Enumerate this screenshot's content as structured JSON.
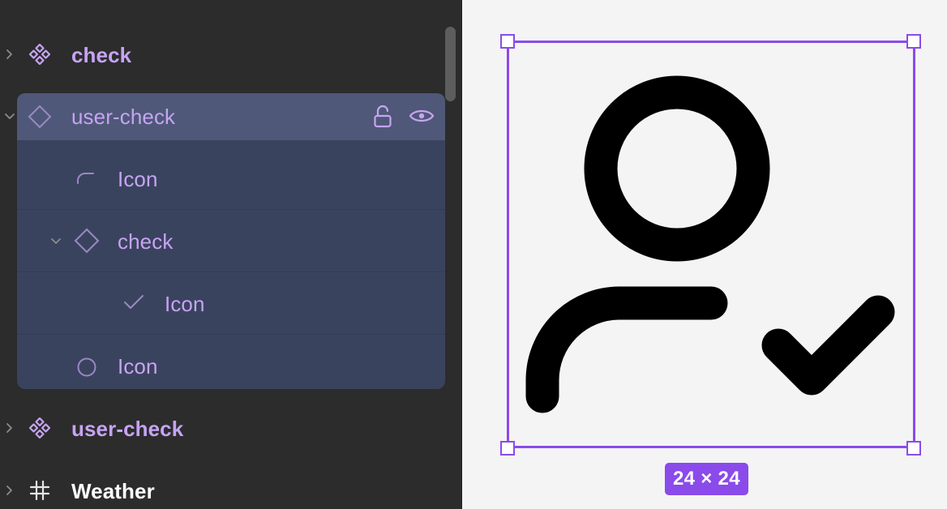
{
  "layers": {
    "items": [
      {
        "label": "check",
        "kind": "component"
      },
      {
        "label": "user-check",
        "kind": "instance",
        "selected": true,
        "children": [
          {
            "label": "Icon",
            "kind": "path"
          },
          {
            "label": "check",
            "kind": "instance"
          },
          {
            "label": "Icon",
            "kind": "check-path"
          },
          {
            "label": "Icon",
            "kind": "ellipse"
          }
        ]
      },
      {
        "label": "user-check",
        "kind": "component"
      },
      {
        "label": "Weather",
        "kind": "frame"
      }
    ]
  },
  "canvas": {
    "size_label": "24 × 24"
  },
  "colors": {
    "accent": "#8a4bea",
    "component_text": "#c6a4f3",
    "panel_bg": "#2c2c2c",
    "selected_row": "#4f5878",
    "selected_group": "#3a435e"
  }
}
